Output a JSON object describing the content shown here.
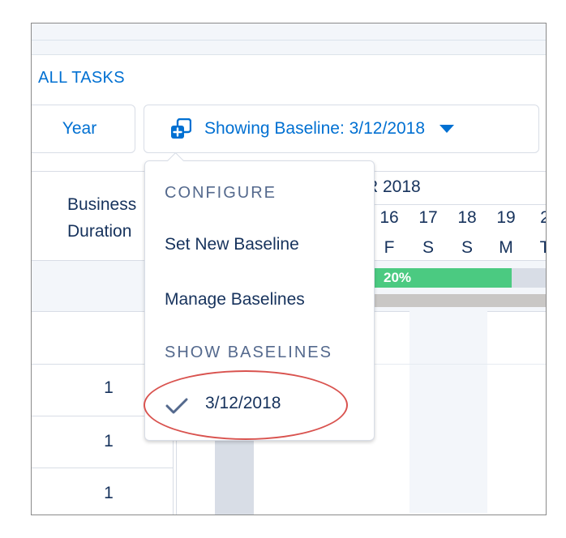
{
  "toolbar": {
    "all_tasks_label": "ALL TASKS",
    "year_button_label": "Year",
    "baseline_button_label": "Showing Baseline: 3/12/2018"
  },
  "grid": {
    "header_line1": "Business",
    "header_line2": "Duration",
    "month_label": "R 2018",
    "days": [
      "16",
      "17",
      "18",
      "19",
      "2"
    ],
    "weekdays": [
      "F",
      "S",
      "S",
      "M",
      "T"
    ],
    "progress_label": "20%",
    "rows": [
      "1",
      "1",
      "1"
    ]
  },
  "dropdown": {
    "configure_header": "CONFIGURE",
    "set_new_baseline": "Set New Baseline",
    "manage_baselines": "Manage Baselines",
    "show_baselines_header": "SHOW BASELINES",
    "selected_baseline": "3/12/2018"
  },
  "colors": {
    "accent": "#0070d2",
    "progress": "#4bca81",
    "highlight_ring": "#d9534f"
  },
  "icons": {
    "baseline_icon": "stacked-squares-plus-icon",
    "caret": "caret-down-icon",
    "check": "check-icon"
  }
}
